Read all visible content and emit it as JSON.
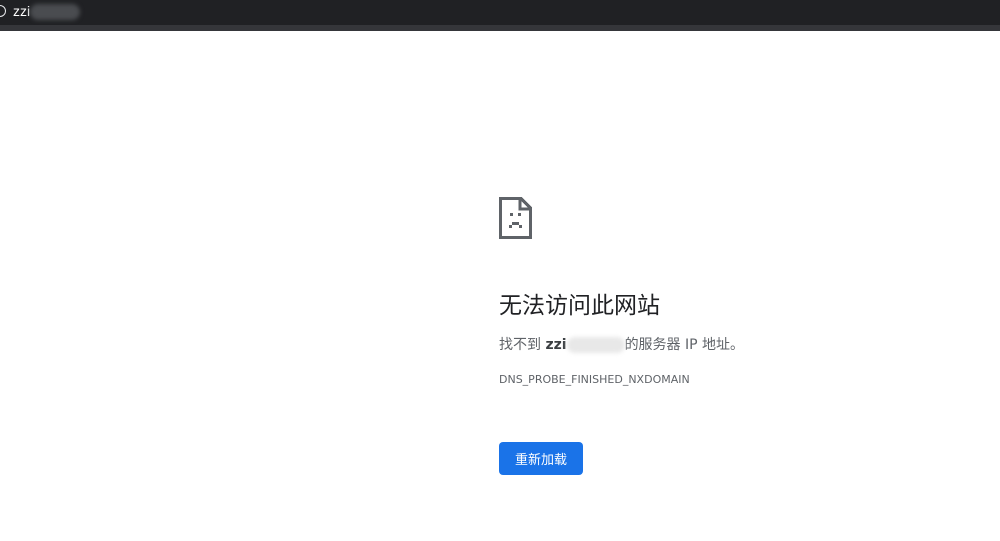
{
  "tab": {
    "title": "zzi"
  },
  "error": {
    "heading": "无法访问此网站",
    "desc_prefix": "找不到 ",
    "domain": "zzi",
    "desc_suffix": "的服务器 IP 地址。",
    "code": "DNS_PROBE_FINISHED_NXDOMAIN",
    "reload_label": "重新加载",
    "icon": "sad-document-icon"
  },
  "colors": {
    "accent": "#1a73e8",
    "topbar": "#202124"
  }
}
